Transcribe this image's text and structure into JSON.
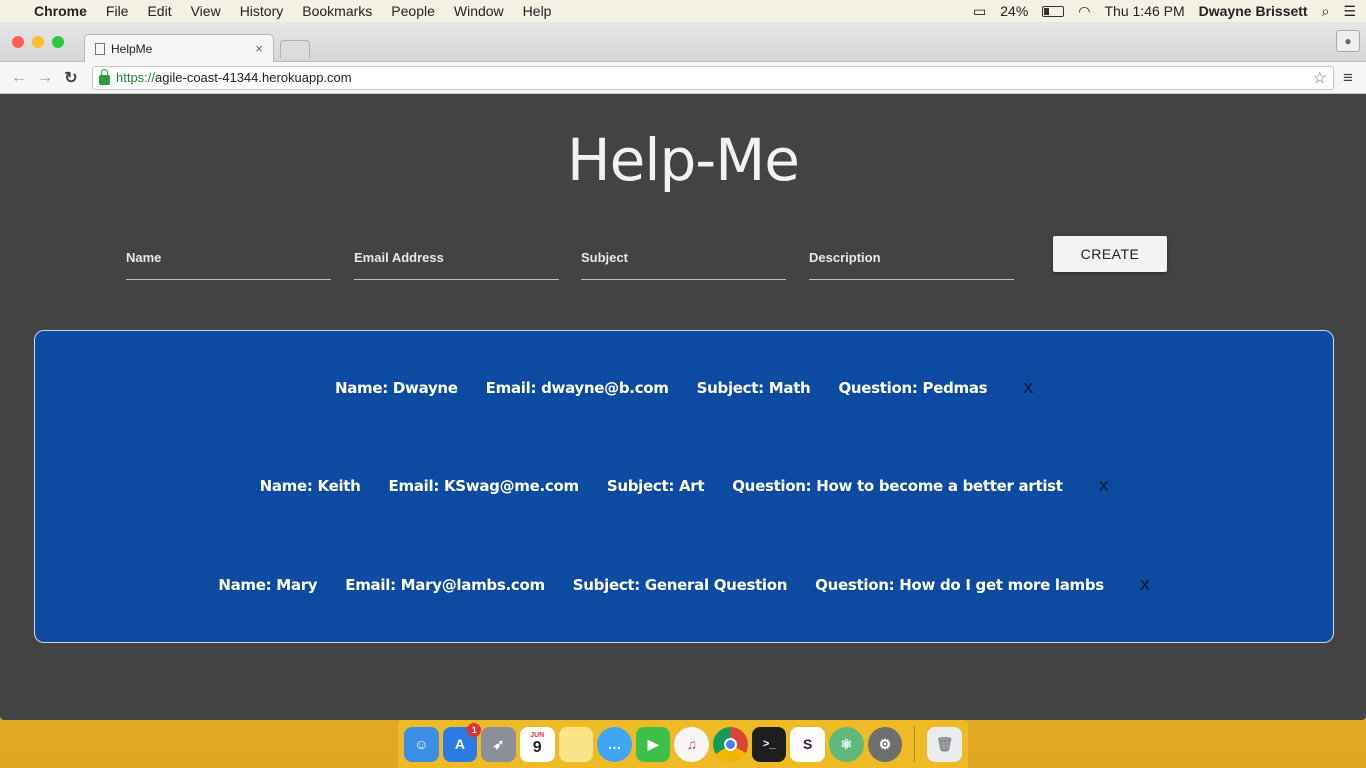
{
  "menubar": {
    "app_name": "Chrome",
    "items": [
      "File",
      "Edit",
      "View",
      "History",
      "Bookmarks",
      "People",
      "Window",
      "Help"
    ],
    "battery": "24%",
    "clock": "Thu 1:46 PM",
    "user": "Dwayne Brissett"
  },
  "browser": {
    "tab_title": "HelpMe",
    "tab_close": "×",
    "url_scheme": "https://",
    "url_host": "agile-coast-41344.herokuapp.com"
  },
  "page": {
    "title": "Help-Me",
    "form": {
      "name_placeholder": "Name",
      "email_placeholder": "Email Address",
      "subject_placeholder": "Subject",
      "description_placeholder": "Description",
      "create_label": "CREATE"
    },
    "tickets": [
      {
        "name": "Name: Dwayne",
        "email": "Email: dwayne@b.com",
        "subject": "Subject: Math",
        "question": "Question: Pedmas",
        "delete": "X"
      },
      {
        "name": "Name: Keith",
        "email": "Email: KSwag@me.com",
        "subject": "Subject: Art",
        "question": "Question: How to become a better artist",
        "delete": "X"
      },
      {
        "name": "Name: Mary",
        "email": "Email: Mary@lambs.com",
        "subject": "Subject: General Question",
        "question": "Question: How do I get more lambs",
        "delete": "X"
      }
    ]
  },
  "dock": {
    "apps": [
      "finder-icon",
      "app-store-icon",
      "launchpad-icon",
      "calendar-icon",
      "notes-icon",
      "messages-icon",
      "facetime-icon",
      "itunes-icon",
      "chrome-icon",
      "terminal-icon",
      "slack-icon",
      "atom-icon",
      "system-preferences-icon",
      "trash-icon"
    ],
    "calendar_day": "9",
    "calendar_month": "JUN",
    "app_store_badge": "1"
  }
}
